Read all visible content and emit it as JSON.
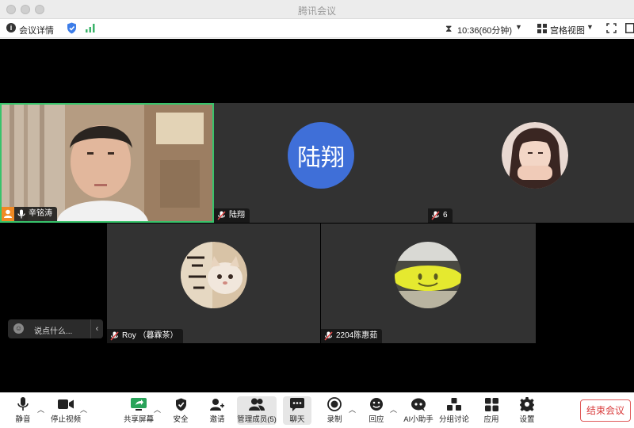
{
  "window": {
    "title": "腾讯会议"
  },
  "infobar": {
    "meeting_info_label": "会议详情",
    "timer": "10:36(60分钟)",
    "view_label": "宫格视图"
  },
  "participants": [
    {
      "name": "辛铭涛",
      "type": "video",
      "speaking": true
    },
    {
      "name": "陆翔",
      "type": "initials",
      "avatar_text": "陆翔",
      "muted": true
    },
    {
      "name": "6",
      "type": "photo",
      "muted": true
    },
    {
      "name": "Roy （暮霖茶）",
      "type": "photo",
      "muted": true
    },
    {
      "name": "2204陈惠茹",
      "type": "photo",
      "muted": true
    }
  ],
  "chat": {
    "placeholder": "说点什么..."
  },
  "toolbar": {
    "mute": "静音",
    "stop_video": "停止视频",
    "share_screen": "共享屏幕",
    "security": "安全",
    "invite": "邀请",
    "manage_members": "管理成员(5)",
    "chat": "聊天",
    "record": "录制",
    "reactions": "回应",
    "ai_assistant": "AI小助手",
    "breakout": "分组讨论",
    "apps": "应用",
    "settings": "设置",
    "end_meeting": "结束会议"
  },
  "colors": {
    "active_speaker_border": "#38c36b",
    "avatar_blue": "#3f6fd8",
    "end_button": "#d93b3b"
  }
}
